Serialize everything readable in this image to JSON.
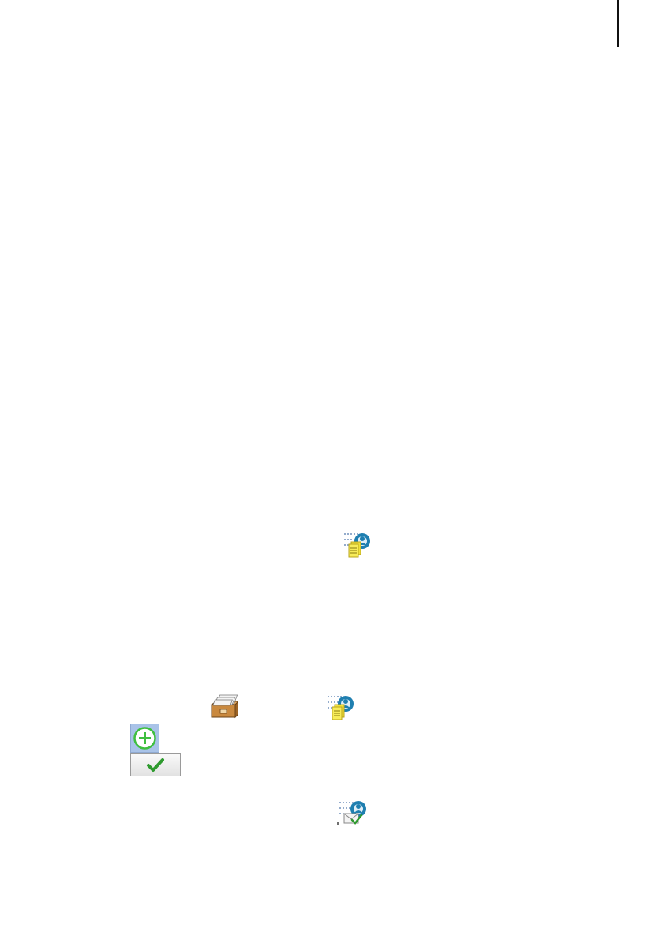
{
  "icons": {
    "export_users": "export-users-icon",
    "database": "database-icon",
    "add": "add-circle-icon",
    "confirm": "checkmark-icon",
    "import_users": "import-users-icon"
  },
  "colors": {
    "background": "#ffffff",
    "add_button_bg": "#a9c3e8",
    "add_icon": "#3fbf3f",
    "check": "#2e9a2e",
    "user_circle": "#1f7fb0",
    "document": "#f2e23a"
  }
}
